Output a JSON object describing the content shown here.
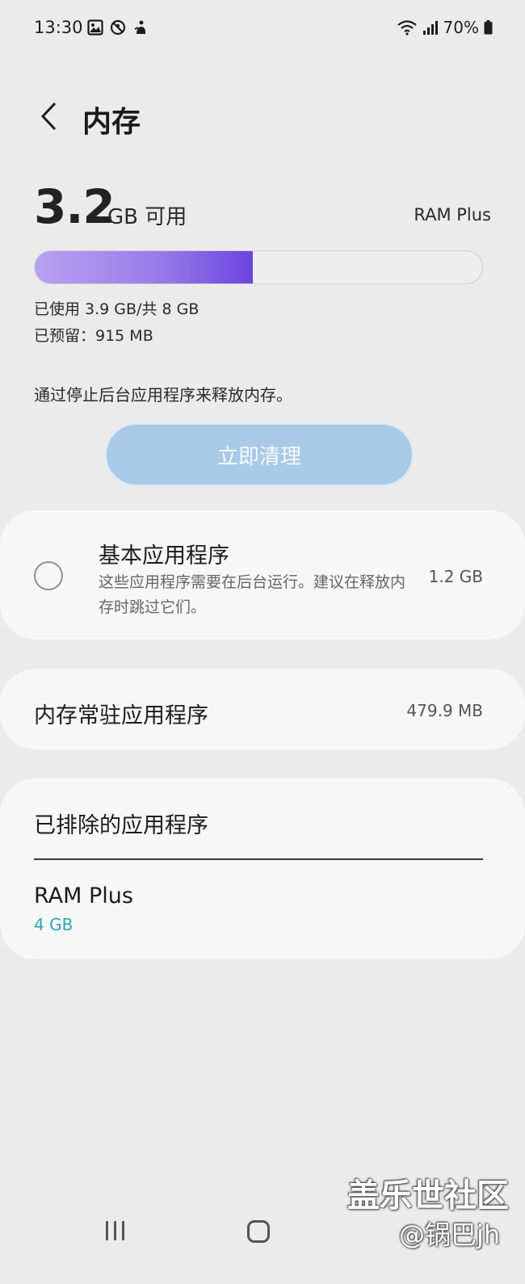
{
  "status_bar": {
    "time": "13:30",
    "left_icons": [
      "image-icon",
      "no-disturb-icon",
      "bixby-icon"
    ],
    "battery_percent": "70%",
    "right_icons": [
      "wifi-icon",
      "signal-icon",
      "battery-icon"
    ]
  },
  "header": {
    "title": "内存",
    "back_icon": "chevron-left-icon"
  },
  "summary": {
    "available_number": "3.2",
    "available_unit": "GB 可用",
    "ram_plus_link": "RAM Plus",
    "used_fraction": 0.4875,
    "used_text": "已使用 3.9 GB/共 8 GB",
    "reserved_text": "已预留：915 MB"
  },
  "hint": "通过停止后台应用程序来释放内存。",
  "clean_button": "立即清理",
  "basic_apps": {
    "title": "基本应用程序",
    "description": "这些应用程序需要在后台运行。建议在释放内存时跳过它们。",
    "size": "1.2 GB",
    "checked": false
  },
  "resident_apps": {
    "title": "内存常驻应用程序",
    "size": "479.9 MB"
  },
  "excluded_apps": {
    "title": "已排除的应用程序"
  },
  "ram_plus": {
    "title": "RAM Plus",
    "value": "4 GB"
  },
  "watermark": {
    "line1": "盖乐世社区",
    "line2": "@锅巴jh"
  },
  "colors": {
    "background": "#ebebeb",
    "card": "#f7f7f7",
    "bar_fill_end": "#6b45de",
    "button": "#a9cae6",
    "accent_teal": "#2aa7b0"
  },
  "nav": {
    "recent_icon": "recent-apps-icon",
    "home_icon": "home-icon"
  }
}
